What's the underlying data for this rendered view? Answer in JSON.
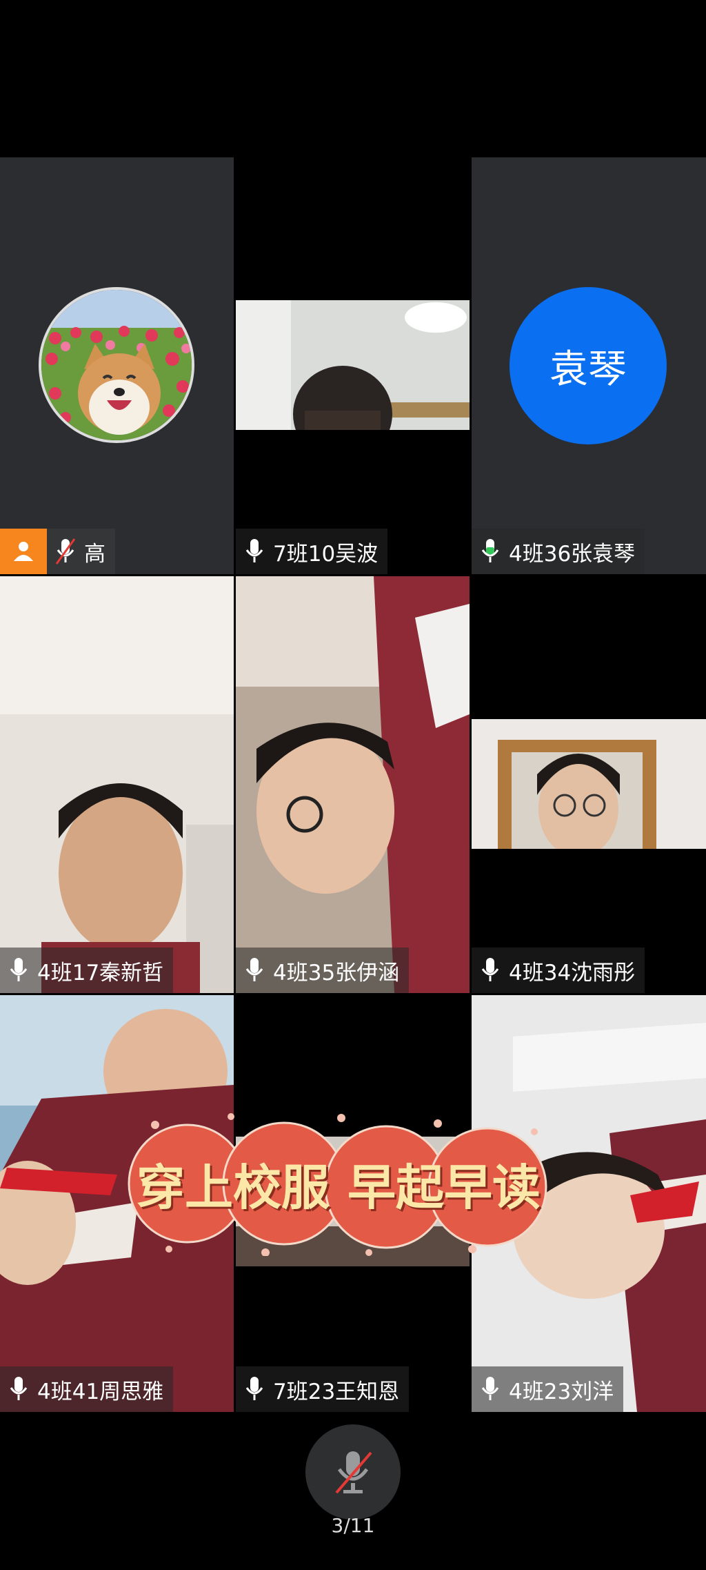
{
  "participants": [
    {
      "name": "高",
      "mic": "muted",
      "host": true
    },
    {
      "name": "7班10吴波",
      "mic": "on"
    },
    {
      "name": "4班36张袁琴",
      "mic": "speaking",
      "avatar_text": "袁琴"
    },
    {
      "name": "4班17秦新哲",
      "mic": "on"
    },
    {
      "name": "4班35张伊涵",
      "mic": "on"
    },
    {
      "name": "4班34沈雨彤",
      "mic": "on"
    },
    {
      "name": "4班41周思雅",
      "mic": "on"
    },
    {
      "name": "7班23王知恩",
      "mic": "on"
    },
    {
      "name": "4班23刘洋",
      "mic": "on"
    }
  ],
  "banner": {
    "text_left": "穿上校服",
    "text_right": "早起早读"
  },
  "footer": {
    "page_indicator": "3/11",
    "mic_state": "muted"
  },
  "colors": {
    "host_badge": "#f7861e",
    "avatar_blue": "#0a6ff0",
    "tile_dark": "#2b2d30",
    "speaking_green": "#34c759"
  }
}
